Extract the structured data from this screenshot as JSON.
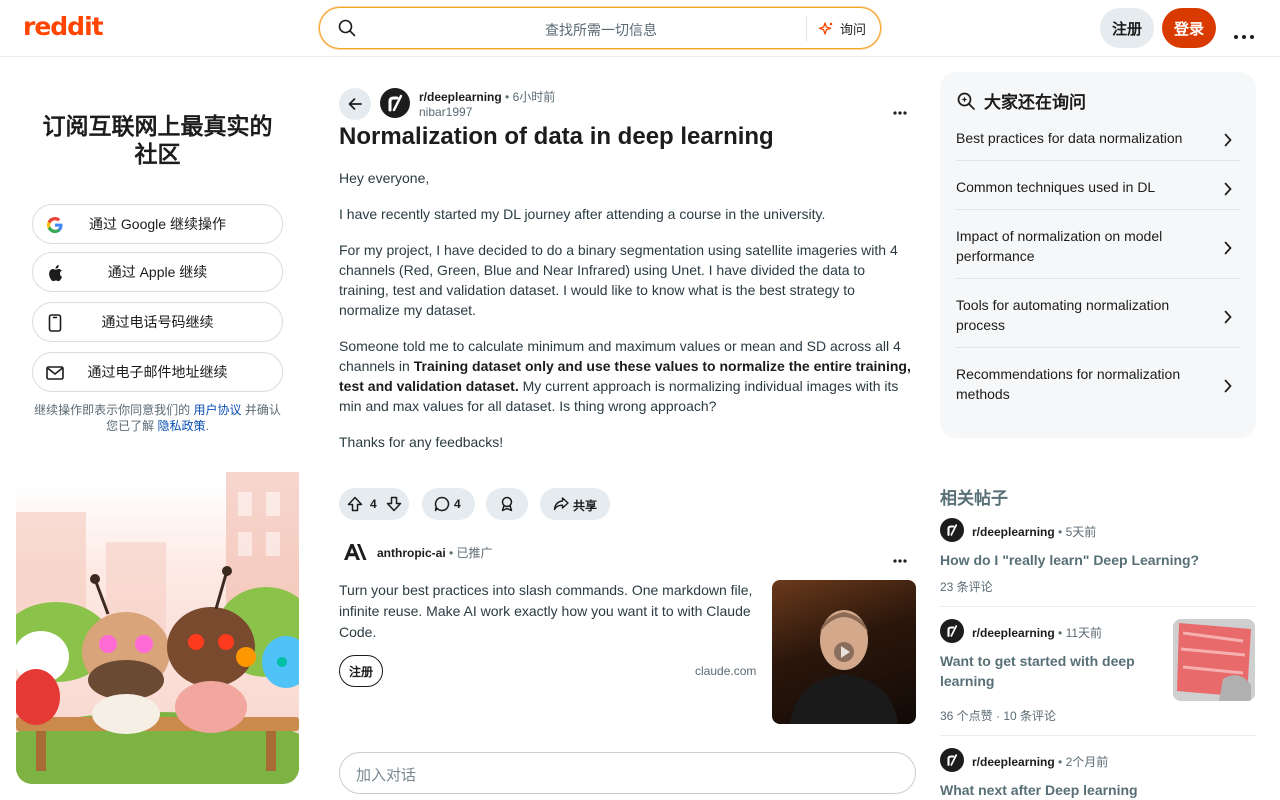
{
  "header": {
    "logo": "reddit",
    "search_placeholder": "查找所需一切信息",
    "ask_label": "询问",
    "signup_label": "注册",
    "login_label": "登录"
  },
  "left_panel": {
    "title_line1": "订阅互联网上最真实的",
    "title_line2": "社区",
    "buttons": [
      {
        "label": "通过 Google 继续操作",
        "icon": "google-icon"
      },
      {
        "label": "通过 Apple 继续",
        "icon": "apple-icon"
      },
      {
        "label": "通过电话号码继续",
        "icon": "phone-icon"
      },
      {
        "label": "通过电子邮件地址继续",
        "icon": "mail-icon"
      }
    ],
    "terms_prefix": "继续操作即表示你同意我们的 ",
    "terms_link": "用户协议",
    "terms_middle": " 并确认您已了解 ",
    "privacy_link": "隐私政策",
    "terms_suffix": "."
  },
  "post": {
    "subreddit": "r/deeplearning",
    "time": "6小时前",
    "author": "nibar1997",
    "title": "Normalization of data in deep learning",
    "p1": "Hey everyone,",
    "p2": "I have recently started my DL journey after attending a course in the university.",
    "p3": "For my project, I have decided to do a binary segmentation using satellite imageries with 4 channels (Red, Green, Blue and Near Infrared) using Unet. I have divided the data to training, test and validation dataset. I would like to know what is the best strategy to normalize my dataset.",
    "p4_a": "Someone told me to calculate minimum and maximum values or mean and SD across all 4 channels in ",
    "p4_bold": "Training dataset only and use these values to normalize the entire training, test and validation dataset.",
    "p4_b": " My current approach is normalizing individual images with its min and max values for all dataset. Is thing wrong approach?",
    "p5": "Thanks for any feedbacks!",
    "votes": "4",
    "comments": "4",
    "share_label": "共享"
  },
  "promo": {
    "account": "anthropic-ai",
    "badge": "已推广",
    "text": "Turn your best practices into slash commands. One markdown file, infinite reuse. Make AI work exactly how you want it to with Claude Code.",
    "cta": "注册",
    "domain": "claude.com"
  },
  "comment_placeholder": "加入对话",
  "ask_panel": {
    "title": "大家还在询问",
    "items": [
      "Best practices for data normalization",
      "Common techniques used in DL",
      "Impact of normalization on model performance",
      "Tools for automating normalization process",
      "Recommendations for normalization methods"
    ]
  },
  "related": {
    "title": "相关帖子",
    "posts": [
      {
        "sub": "r/deeplearning",
        "time": "5天前",
        "title": "How do I \"really learn\" Deep Learning?",
        "stats": "23 条评论"
      },
      {
        "sub": "r/deeplearning",
        "time": "11天前",
        "title": "Want to get started with deep learning",
        "stats": "36 个点赞 · 10 条评论"
      },
      {
        "sub": "r/deeplearning",
        "time": "2个月前",
        "title": "What next after Deep learning"
      }
    ]
  },
  "colors": {
    "brand": "#ff4500",
    "login": "#d93a00",
    "link": "#0b4fb8"
  }
}
